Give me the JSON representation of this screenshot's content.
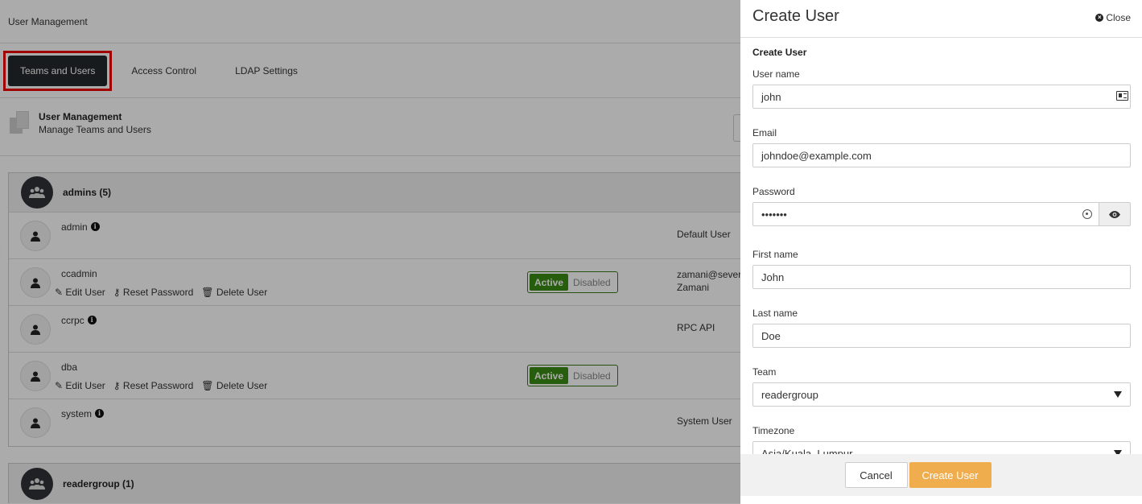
{
  "app": {
    "title": "User Management",
    "tabs": [
      {
        "label": "Teams and Users"
      },
      {
        "label": "Access Control"
      },
      {
        "label": "LDAP Settings"
      }
    ],
    "header": {
      "title": "User Management",
      "subtitle": "Manage Teams and Users"
    },
    "groups": [
      {
        "name": "admins (5)",
        "users": [
          {
            "name": "admin",
            "desc": "Default User"
          },
          {
            "name": "ccadmin",
            "desc": "zamani@sever",
            "desc2": "Zamani",
            "active": "Active",
            "disabled": "Disabled"
          },
          {
            "name": "ccrpc",
            "desc": "RPC API"
          },
          {
            "name": "dba",
            "active": "Active",
            "disabled": "Disabled"
          },
          {
            "name": "system",
            "desc": "System User"
          }
        ]
      },
      {
        "name": "readergroup (1)"
      }
    ],
    "actions": {
      "edit": "Edit User",
      "reset": "Reset Password",
      "delete": "Delete User"
    }
  },
  "panel": {
    "title": "Create User",
    "close_label": "Close",
    "section": "Create User",
    "fields": {
      "username": {
        "label": "User name",
        "value": "john"
      },
      "email": {
        "label": "Email",
        "value": "johndoe@example.com"
      },
      "password": {
        "label": "Password",
        "value": "•••••••"
      },
      "first_name": {
        "label": "First name",
        "value": "John"
      },
      "last_name": {
        "label": "Last name",
        "value": "Doe"
      },
      "team": {
        "label": "Team",
        "value": "readergroup"
      },
      "timezone": {
        "label": "Timezone",
        "value": "Asia/Kuala_Lumpur"
      }
    },
    "cancel_label": "Cancel",
    "create_label": "Create User"
  },
  "colors": {
    "accent": "#f0ad4e",
    "active_green": "#3a8c14",
    "highlight_red": "#e00000",
    "dark_tab": "#25292e"
  }
}
